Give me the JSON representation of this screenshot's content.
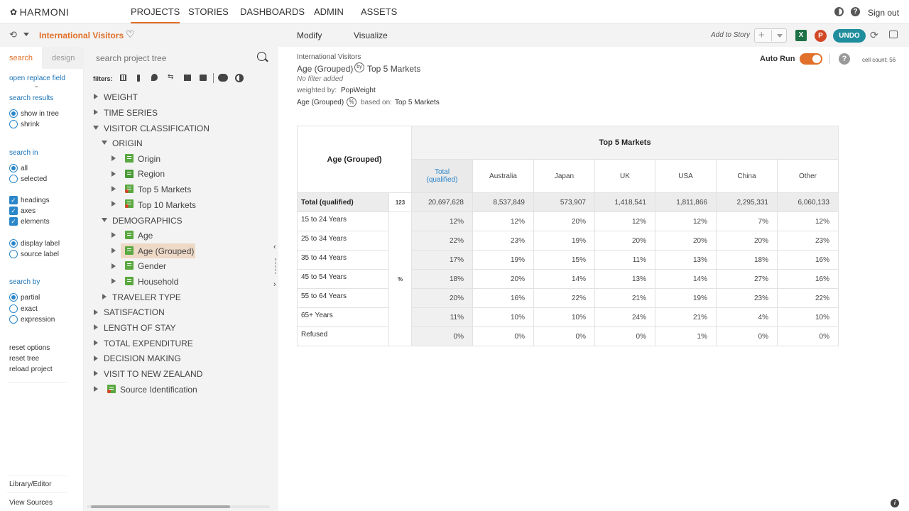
{
  "app": {
    "brand": "HARMONI"
  },
  "nav": {
    "items": [
      "PROJECTS",
      "STORIES",
      "DASHBOARDS",
      "ADMIN",
      "ASSETS"
    ],
    "active": "PROJECTS",
    "sign_out": "Sign out"
  },
  "project": {
    "title": "International Visitors"
  },
  "toolbar": {
    "modify": "Modify",
    "visualize": "Visualize",
    "add_to_story": "Add to Story",
    "undo": "UNDO"
  },
  "panel_tabs": {
    "search": "search",
    "design": "design"
  },
  "search": {
    "placeholder": "search project tree"
  },
  "filters_label": "filters:",
  "options": {
    "open_replace_field": "open replace field",
    "search_results": "search results",
    "show_in_tree": "show in tree",
    "shrink": "shrink",
    "search_in": "search in",
    "all": "all",
    "selected": "selected",
    "headings": "headings",
    "axes": "axes",
    "elements": "elements",
    "display_label": "display label",
    "source_label": "source label",
    "search_by": "search by",
    "partial": "partial",
    "exact": "exact",
    "expression": "expression",
    "reset_options": "reset options",
    "reset_tree": "reset tree",
    "reload_project": "reload project",
    "library_editor": "Library/Editor",
    "view_sources": "View Sources"
  },
  "tree": {
    "weight": "WEIGHT",
    "time_series": "TIME SERIES",
    "visitor_classification": "VISITOR CLASSIFICATION",
    "origin": "ORIGIN",
    "origin_var": "Origin",
    "region": "Region",
    "top5": "Top 5 Markets",
    "top10": "Top 10 Markets",
    "demographics": "DEMOGRAPHICS",
    "age": "Age",
    "age_grouped": "Age (Grouped)",
    "gender": "Gender",
    "household": "Household",
    "traveler_type": "TRAVELER TYPE",
    "satisfaction": "SATISFACTION",
    "length_of_stay": "LENGTH OF STAY",
    "total_expenditure": "TOTAL EXPENDITURE",
    "decision_making": "DECISION MAKING",
    "visit_nz": "VISIT TO NEW ZEALAND",
    "source_identification": "Source Identification"
  },
  "report": {
    "project": "International Visitors",
    "row_var": "Age (Grouped)",
    "by": "by",
    "col_var": "Top 5 Markets",
    "filter": "No filter added",
    "weighted_label": "weighted by:",
    "weight": "PopWeight",
    "pct_row": "Age (Grouped)",
    "pct": "%",
    "based_label": "based on:",
    "based": "Top 5 Markets",
    "auto_run": "Auto Run",
    "cell_count": "cell count: 56"
  },
  "crosstab": {
    "row_header": "Age (Grouped)",
    "banner": "Top 5 Markets",
    "columns": [
      "Total (qualified)",
      "Australia",
      "Japan",
      "UK",
      "USA",
      "China",
      "Other"
    ],
    "total_label": "Total (qualified)",
    "count_badge": "123",
    "pct_badge": "%",
    "totals": [
      "20,697,628",
      "8,537,849",
      "573,907",
      "1,418,541",
      "1,811,866",
      "2,295,331",
      "6,060,133"
    ],
    "rows": [
      {
        "label": "15 to 24 Years",
        "values": [
          "12%",
          "12%",
          "20%",
          "12%",
          "12%",
          "7%",
          "12%"
        ]
      },
      {
        "label": "25 to 34 Years",
        "values": [
          "22%",
          "23%",
          "19%",
          "20%",
          "20%",
          "20%",
          "23%"
        ]
      },
      {
        "label": "35 to 44 Years",
        "values": [
          "17%",
          "19%",
          "15%",
          "11%",
          "13%",
          "18%",
          "16%"
        ]
      },
      {
        "label": "45 to 54 Years",
        "values": [
          "18%",
          "20%",
          "14%",
          "13%",
          "14%",
          "27%",
          "16%"
        ]
      },
      {
        "label": "55 to 64 Years",
        "values": [
          "20%",
          "16%",
          "22%",
          "21%",
          "19%",
          "23%",
          "22%"
        ]
      },
      {
        "label": "65+ Years",
        "values": [
          "11%",
          "10%",
          "10%",
          "24%",
          "21%",
          "4%",
          "10%"
        ]
      },
      {
        "label": "Refused",
        "values": [
          "0%",
          "0%",
          "0%",
          "0%",
          "1%",
          "0%",
          "0%"
        ]
      }
    ]
  },
  "colors": {
    "accent": "#e0702a",
    "blue": "#2a86c9",
    "teal": "#1f8d9c",
    "green": "#5aa840"
  }
}
